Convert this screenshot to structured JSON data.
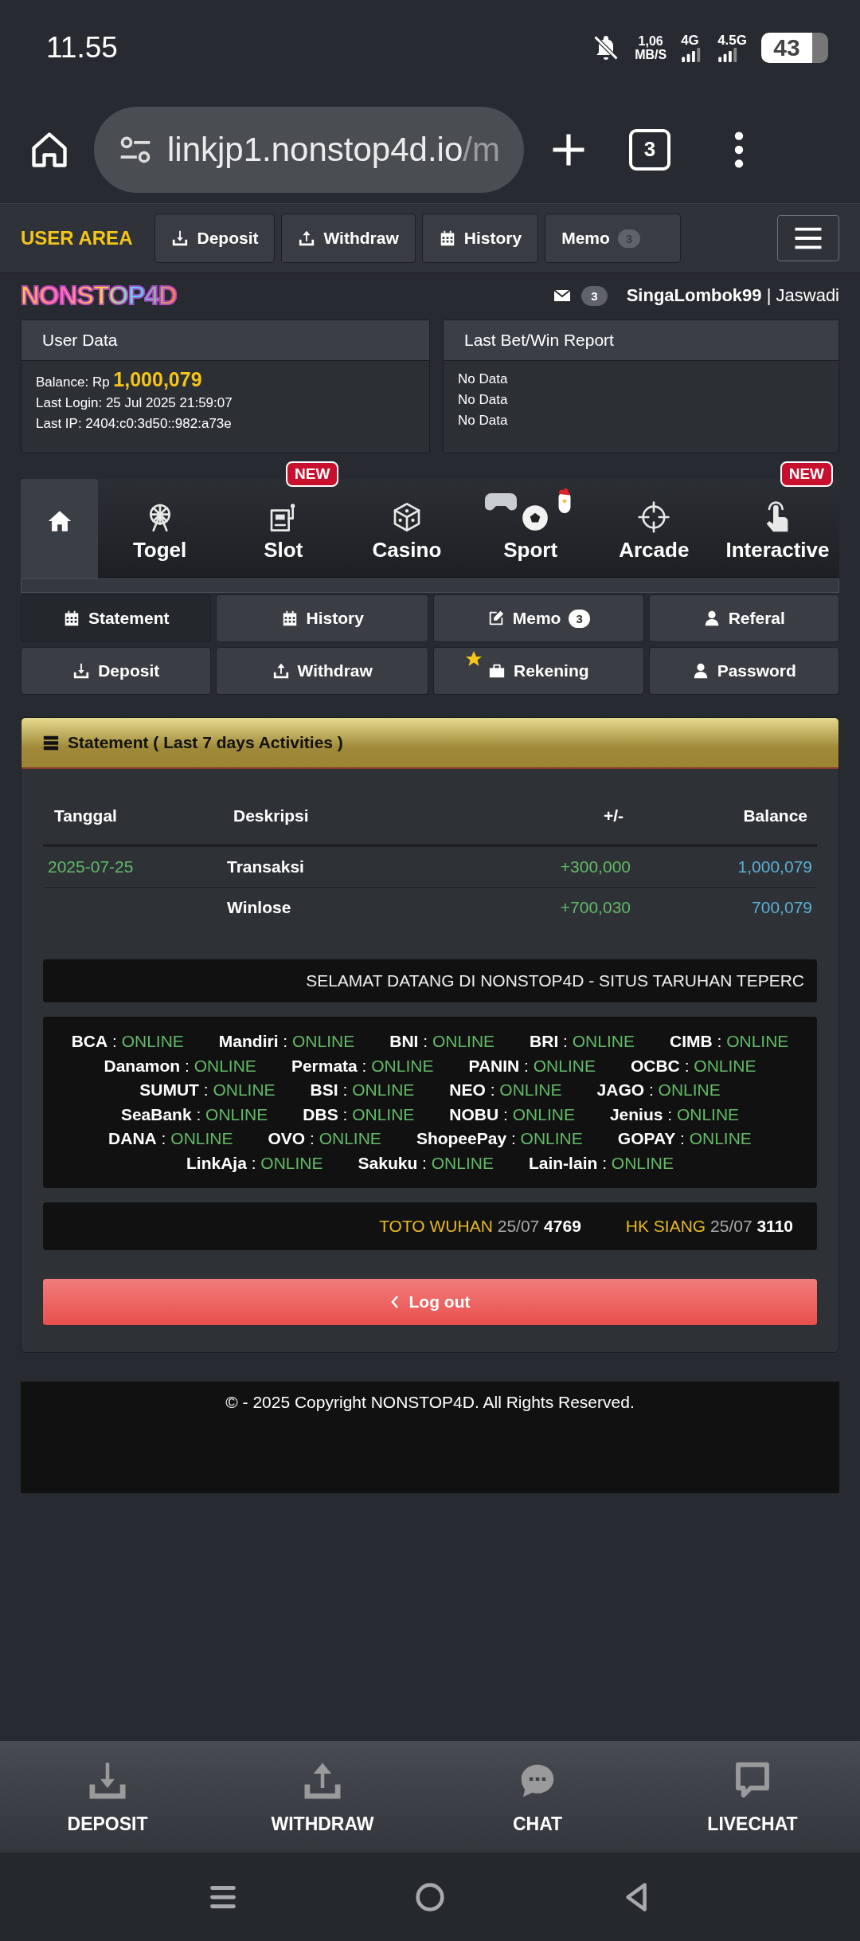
{
  "status_bar": {
    "time": "11.55",
    "speed": [
      "1,06",
      "MB/S"
    ],
    "networks": [
      "4G",
      "4.5G"
    ],
    "battery": "43"
  },
  "browser": {
    "url_host": "linkjp1.nonstop4d.io",
    "url_path": "/m",
    "tab_count": "3"
  },
  "header": {
    "title": "USER AREA",
    "buttons": [
      {
        "label": "Deposit",
        "kind": "deposit"
      },
      {
        "label": "Withdraw",
        "kind": "withdraw"
      },
      {
        "label": "History",
        "kind": "calendar"
      },
      {
        "label": "Memo",
        "kind": "memo",
        "badge": "3"
      }
    ]
  },
  "logo": "NONSTOP4D",
  "user_bar": {
    "mail_count": "3",
    "user": "**SingaLombok99** | Jaswadi"
  },
  "user_data": {
    "title": "User Data",
    "balance_label": "Balance: Rp",
    "balance": "1,000,079",
    "lines": [
      "Last Login: 25 Jul 2025 21:59:07",
      "Last IP: 2404:c0:3d50::982:a73e"
    ]
  },
  "report": {
    "title": "Last Bet/Win Report",
    "lines": [
      "No Data",
      "No Data",
      "No Data"
    ]
  },
  "categories": [
    {
      "kind": "home",
      "selected": true
    },
    {
      "label": "Togel",
      "kind": "togel",
      "selected": false
    },
    {
      "label": "Slot",
      "kind": "slot",
      "badge": "NEW",
      "selected": false
    },
    {
      "label": "Casino",
      "kind": "dice",
      "selected": false
    },
    {
      "label": "Sport",
      "kind": "sport",
      "selected": false
    },
    {
      "label": "Arcade",
      "kind": "crosshair",
      "selected": false
    },
    {
      "label": "Interactive",
      "kind": "hand",
      "badge": "NEW",
      "selected": false
    }
  ],
  "sub_menu": [
    {
      "label": "Statement",
      "kind": "calendar",
      "selected": true,
      "starred": false
    },
    {
      "label": "History",
      "kind": "calendar",
      "selected": false,
      "starred": false
    },
    {
      "label": "Memo",
      "kind": "edit",
      "badge": "3",
      "selected": false,
      "starred": false
    },
    {
      "label": "Referal",
      "kind": "user",
      "selected": false,
      "starred": false
    },
    {
      "label": "Deposit",
      "kind": "deposit",
      "selected": false,
      "starred": false
    },
    {
      "label": "Withdraw",
      "kind": "withdraw",
      "selected": false,
      "starred": false
    },
    {
      "label": "Rekening",
      "kind": "briefcase",
      "selected": false,
      "starred": true
    },
    {
      "label": "Password",
      "kind": "user",
      "selected": false,
      "starred": false
    }
  ],
  "statement": {
    "title": "Statement ( Last 7 days Activities )",
    "columns": [
      "Tanggal",
      "Deskripsi",
      "+/-",
      "Balance"
    ],
    "rows": [
      {
        "date": "2025-07-25",
        "description": "Transaksi",
        "change": "+300,000",
        "balance": "1,000,079"
      },
      {
        "description": "Winlose",
        "change": "+700,030",
        "balance": "700,079"
      }
    ],
    "marquee": "SELAMAT DATANG DI NONSTOP4D - SITUS TARUHAN TEPERC",
    "banks": [
      [
        {
          "name": "**BCA** :",
          "status": "ONLINE"
        },
        {
          "name": "**Mandiri** :",
          "status": "ONLINE"
        },
        {
          "name": "**BNI** :",
          "status": "ONLINE"
        },
        {
          "name": "**BRI** :",
          "status": "ONLINE"
        },
        {
          "name": "**CIMB** :",
          "status": "ONLINE"
        }
      ],
      [
        {
          "name": "**Danamon** :",
          "status": "ONLINE"
        },
        {
          "name": "**Permata** :",
          "status": "ONLINE"
        },
        {
          "name": "**PANIN** :",
          "status": "ONLINE"
        },
        {
          "name": "**OCBC** :",
          "status": "ONLINE"
        }
      ],
      [
        {
          "name": "**SUMUT** :",
          "status": "ONLINE"
        },
        {
          "name": "**BSI** :",
          "status": "ONLINE"
        },
        {
          "name": "**NEO** :",
          "status": "ONLINE"
        },
        {
          "name": "**JAGO** :",
          "status": "ONLINE"
        }
      ],
      [
        {
          "name": "**SeaBank** :",
          "status": "ONLINE"
        },
        {
          "name": "**DBS** :",
          "status": "ONLINE"
        },
        {
          "name": "**NOBU** :",
          "status": "ONLINE"
        },
        {
          "name": "**Jenius** :",
          "status": "ONLINE"
        }
      ],
      [
        {
          "name": "**DANA** :",
          "status": "ONLINE"
        },
        {
          "name": "**OVO** :",
          "status": "ONLINE"
        },
        {
          "name": "**ShopeePay** :",
          "status": "ONLINE"
        },
        {
          "name": "**GOPAY** :",
          "status": "ONLINE"
        }
      ],
      [
        {
          "name": "**LinkAja** :",
          "status": "ONLINE"
        },
        {
          "name": "**Sakuku** :",
          "status": "ONLINE"
        },
        {
          "name": "**Lain-lain** :",
          "status": "ONLINE"
        }
      ]
    ],
    "results": [
      {
        "market": "TOTO WUHAN",
        "date": "25/07",
        "number": "4769"
      },
      {
        "market": "HK SIANG",
        "date": "25/07",
        "number": "3110"
      }
    ],
    "logout": "Log out"
  },
  "footer": "© - 2025 Copyright NONSTOP4D. All Rights Reserved.",
  "bottom_nav": [
    {
      "label": "DEPOSIT",
      "kind": "deposit"
    },
    {
      "label": "WITHDRAW",
      "kind": "withdraw"
    },
    {
      "label": "CHAT",
      "kind": "chat"
    },
    {
      "label": "LIVECHAT",
      "kind": "livechat"
    }
  ]
}
